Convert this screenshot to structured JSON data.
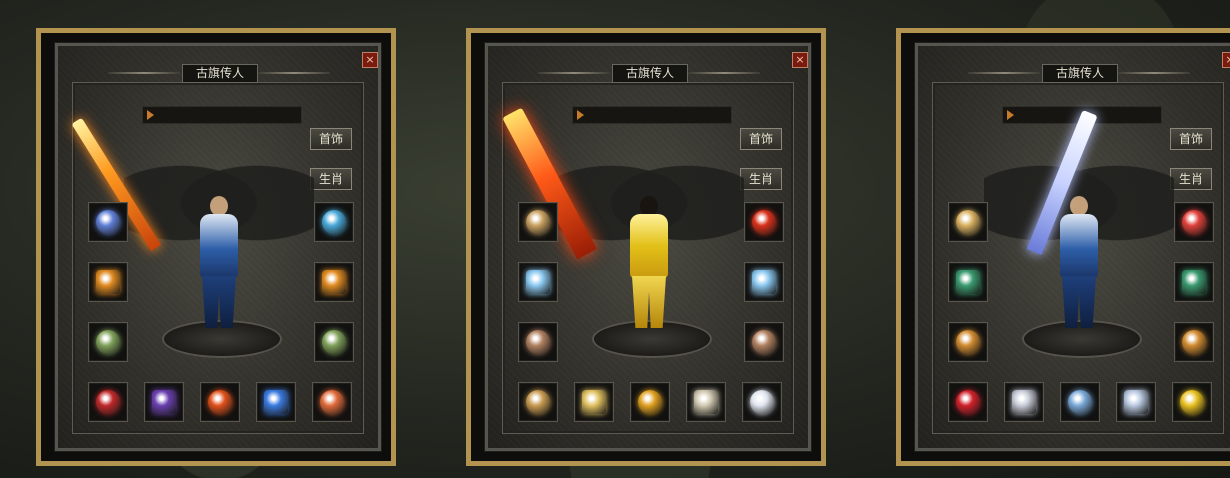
{
  "panels": [
    {
      "title": "古旗传人",
      "buttons": [
        "首饰",
        "生肖"
      ],
      "weapon": "fire",
      "figure": "blue",
      "slots": {
        "left": [
          "#5f7fd6",
          "#e08a20",
          "#7fa05a"
        ],
        "right": [
          "#49a8d8",
          "#e08a20",
          "#7fa05a"
        ],
        "bottom": [
          "#c0282a",
          "#6a3fb0",
          "#e0501a",
          "#3a7ae0",
          "#e06a3a"
        ]
      },
      "slot_icons": {
        "left": [
          "dragon-necklace-icon",
          "flame-helmet-icon",
          "jade-ring-icon"
        ],
        "right": [
          "crescent-bracelet-icon",
          "flame-helmet-icon",
          "jade-ring-icon"
        ],
        "bottom": [
          "potion-icon",
          "demon-mask-icon",
          "tian-medal-icon",
          "lightning-boots-icon",
          "crossed-blades-icon"
        ]
      }
    },
    {
      "title": "古旗传人",
      "buttons": [
        "首饰",
        "生肖"
      ],
      "weapon": "flame",
      "figure": "gold",
      "slots": {
        "left": [
          "#c8a060",
          "#8ac8f0",
          "#b08060"
        ],
        "right": [
          "#d8301a",
          "#8ac8f0",
          "#b08060"
        ],
        "bottom": [
          "#c89a50",
          "#e0c060",
          "#e0a020",
          "#d0c8b0",
          "#dfe4ee"
        ]
      },
      "slot_icons": {
        "left": [
          "spellbook-icon",
          "ice-bracelet-icon",
          "bone-ring-icon"
        ],
        "right": [
          "fire-claw-icon",
          "ice-bracelet-icon",
          "bone-ring-icon"
        ],
        "bottom": [
          "scroll-icon",
          "golden-belt-icon",
          "golden-skull-icon",
          "bone-boots-icon",
          "frost-gem-icon"
        ]
      }
    },
    {
      "title": "古旗传人",
      "buttons": [
        "首饰",
        "生肖"
      ],
      "weapon": "ice",
      "figure": "blue",
      "slots": {
        "left": [
          "#d8b060",
          "#3a9a70",
          "#d08a30"
        ],
        "right": [
          "#e0403a",
          "#3a9a70",
          "#d08a30"
        ],
        "bottom": [
          "#d0202a",
          "#c8ccd8",
          "#7aa8d8",
          "#b8c8e0",
          "#e8c020"
        ]
      },
      "slot_icons": {
        "left": [
          "sun-medallion-icon",
          "serpent-bracelet-icon",
          "amber-ring-icon"
        ],
        "right": [
          "crimson-shield-icon",
          "serpent-bracelet-icon",
          "amber-ring-icon"
        ],
        "bottom": [
          "red-orb-icon",
          "silver-belt-icon",
          "ice-tablet-icon",
          "silver-boots-icon",
          "gold-star-icon"
        ]
      }
    }
  ]
}
